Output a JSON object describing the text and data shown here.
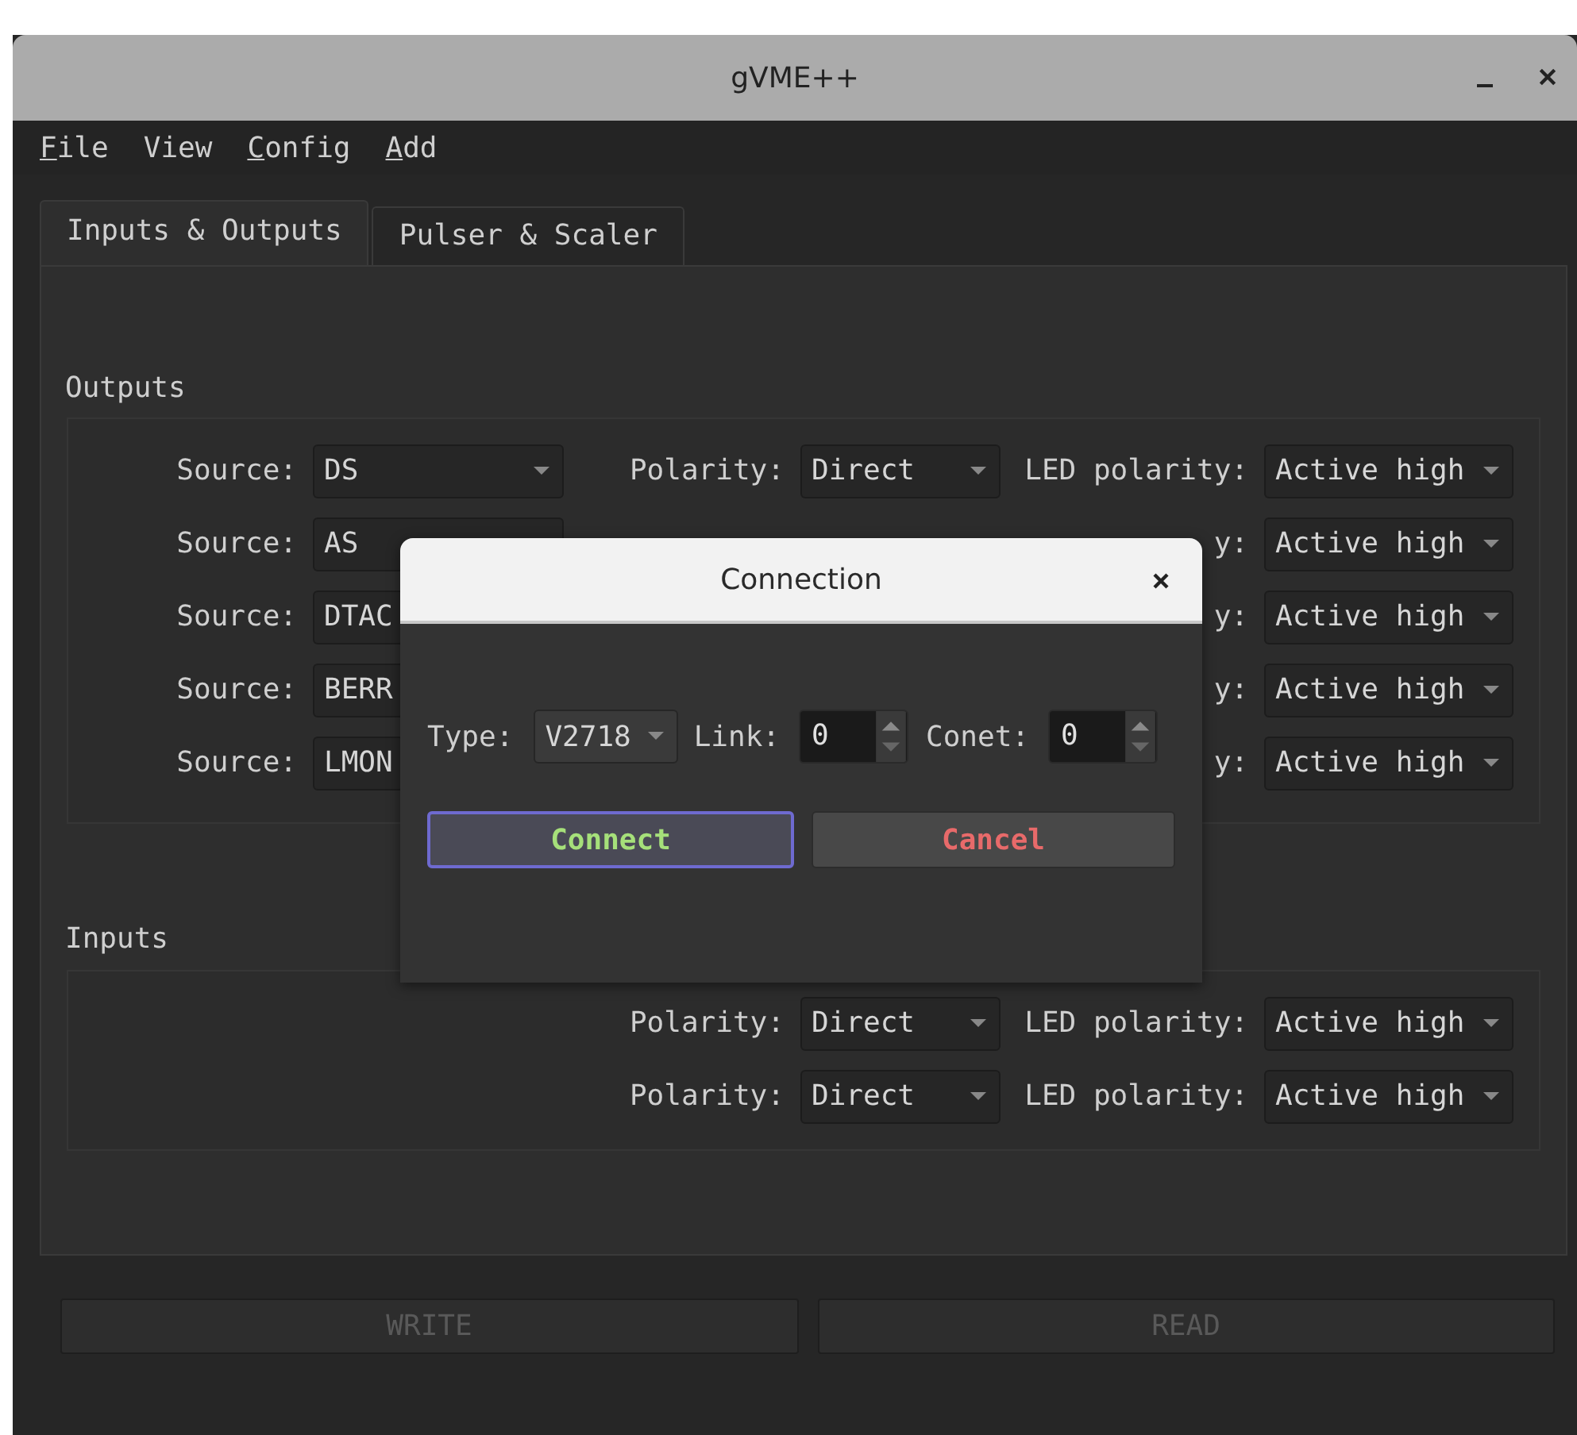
{
  "window": {
    "title": "gVME++"
  },
  "menu": [
    {
      "label": "File",
      "underline_first": true
    },
    {
      "label": "View",
      "underline_first": false
    },
    {
      "label": "Config",
      "underline_first": true
    },
    {
      "label": "Add",
      "underline_first": true
    }
  ],
  "tabs": [
    {
      "label": "Inputs & Outputs",
      "selected": true
    },
    {
      "label": "Pulser & Scaler",
      "selected": false
    }
  ],
  "outputs": {
    "title": "Outputs",
    "rows": [
      {
        "source_label": "Source:",
        "source": "DS",
        "polarity_label": "Polarity:",
        "polarity": "Direct",
        "led_label": "LED polarity:",
        "led": "Active high"
      },
      {
        "source_label": "Source:",
        "source": "AS",
        "led_label": "y:",
        "led": "Active high"
      },
      {
        "source_label": "Source:",
        "source": "DTAC",
        "led_label": "y:",
        "led": "Active high"
      },
      {
        "source_label": "Source:",
        "source": "BERR",
        "led_label": "y:",
        "led": "Active high"
      },
      {
        "source_label": "Source:",
        "source": "LMON",
        "led_label": "y:",
        "led": "Active high"
      }
    ]
  },
  "inputs": {
    "title": "Inputs",
    "rows": [
      {
        "polarity_label": "Polarity:",
        "polarity": "Direct",
        "led_label": "LED polarity:",
        "led": "Active high"
      },
      {
        "polarity_label": "Polarity:",
        "polarity": "Direct",
        "led_label": "LED polarity:",
        "led": "Active high"
      }
    ]
  },
  "buttons": [
    {
      "label": "WRITE",
      "disabled": true
    },
    {
      "label": "READ",
      "disabled": true
    }
  ],
  "dialog": {
    "title": "Connection",
    "type_label": "Type:",
    "type": "V2718",
    "link_label": "Link:",
    "link": "0",
    "conet_label": "Conet:",
    "conet": "0",
    "buttons": [
      {
        "label": "Connect",
        "kind": "confirm",
        "focused": true
      },
      {
        "label": "Cancel",
        "kind": "cancel",
        "focused": false
      }
    ]
  }
}
